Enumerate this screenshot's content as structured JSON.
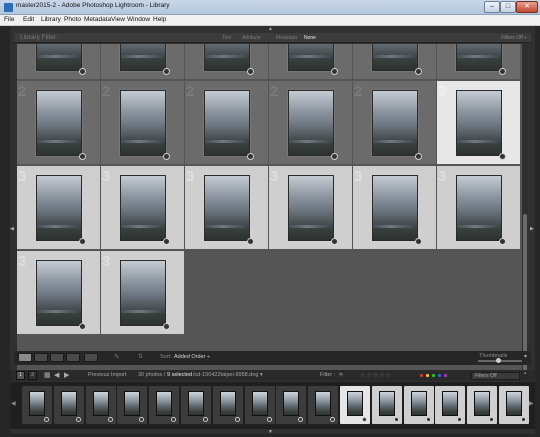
{
  "window": {
    "title": "master2015-2 - Adobe Photoshop Lightroom - Library",
    "minimize": "–",
    "maximize": "□",
    "close": "✕"
  },
  "menu": [
    "File",
    "Edit",
    "Library",
    "Photo",
    "Metadata",
    "View",
    "Window",
    "Help"
  ],
  "library_filter": {
    "title": "Library Filter :",
    "options": [
      "Text",
      "Attribute",
      "Metadata",
      "None"
    ],
    "active": "None",
    "filters_off": "Filters Off ÷"
  },
  "grid": {
    "rows": [
      [
        "",
        "",
        "",
        "",
        "",
        ""
      ],
      [
        "2",
        "2",
        "2",
        "2",
        "2",
        "2"
      ],
      [
        "3",
        "3",
        "3",
        "3",
        "3",
        "3"
      ],
      [
        "3",
        "3"
      ]
    ],
    "selected_row_index": 2,
    "last_selected": [
      1,
      5
    ]
  },
  "toolbar": {
    "sort_label": "Sort:",
    "sort_value": "Added Order ÷",
    "thumbnails_label": "Thumbnails"
  },
  "filmstrip_bar": {
    "page_1": "1",
    "page_2": "2",
    "source": "Previous Import",
    "count": "30 photos /",
    "selected": "9 selected",
    "path": "/cd-150422taipei-9958.dng ▾",
    "filter_label": "Filter :",
    "stars": "☆☆☆☆☆",
    "filters_off": "Filters Off"
  },
  "filmstrip": {
    "count": 16,
    "selected_from": 10,
    "last_selected": 10
  },
  "colors": {
    "selected_cell": "#cfcfcf",
    "last_selected_cell": "#e7e7e7",
    "unselected_cell": "#6b6b6b",
    "grid_bg": "#555555"
  }
}
